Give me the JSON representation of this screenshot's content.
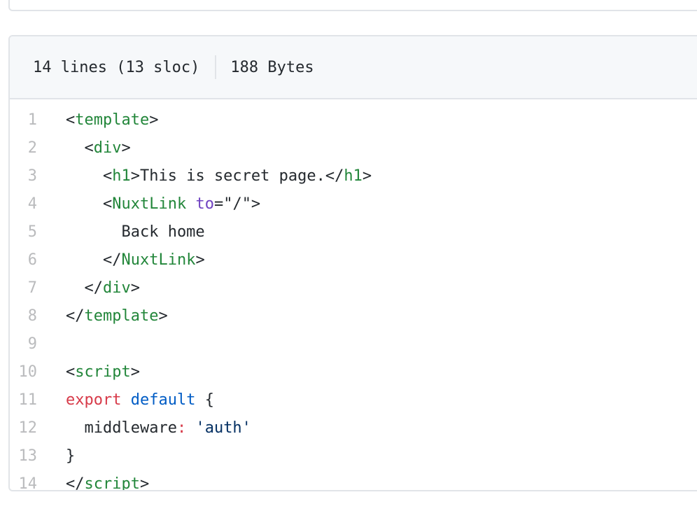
{
  "header": {
    "lines_info": "14 lines (13 sloc)",
    "size_info": "188 Bytes"
  },
  "code": {
    "lines": [
      {
        "num": "1",
        "tokens": [
          {
            "t": "<",
            "c": "plain"
          },
          {
            "t": "template",
            "c": "tag"
          },
          {
            "t": ">",
            "c": "plain"
          }
        ]
      },
      {
        "num": "2",
        "tokens": [
          {
            "t": "  <",
            "c": "plain"
          },
          {
            "t": "div",
            "c": "tag"
          },
          {
            "t": ">",
            "c": "plain"
          }
        ]
      },
      {
        "num": "3",
        "tokens": [
          {
            "t": "    <",
            "c": "plain"
          },
          {
            "t": "h1",
            "c": "tag"
          },
          {
            "t": ">This is secret page.</",
            "c": "plain"
          },
          {
            "t": "h1",
            "c": "tag"
          },
          {
            "t": ">",
            "c": "plain"
          }
        ]
      },
      {
        "num": "4",
        "tokens": [
          {
            "t": "    <",
            "c": "plain"
          },
          {
            "t": "NuxtLink",
            "c": "tag"
          },
          {
            "t": " ",
            "c": "plain"
          },
          {
            "t": "to",
            "c": "attr"
          },
          {
            "t": "=\"/\">",
            "c": "plain"
          }
        ]
      },
      {
        "num": "5",
        "tokens": [
          {
            "t": "      Back home",
            "c": "plain"
          }
        ]
      },
      {
        "num": "6",
        "tokens": [
          {
            "t": "    </",
            "c": "plain"
          },
          {
            "t": "NuxtLink",
            "c": "tag"
          },
          {
            "t": ">",
            "c": "plain"
          }
        ]
      },
      {
        "num": "7",
        "tokens": [
          {
            "t": "  </",
            "c": "plain"
          },
          {
            "t": "div",
            "c": "tag"
          },
          {
            "t": ">",
            "c": "plain"
          }
        ]
      },
      {
        "num": "8",
        "tokens": [
          {
            "t": "</",
            "c": "plain"
          },
          {
            "t": "template",
            "c": "tag"
          },
          {
            "t": ">",
            "c": "plain"
          }
        ]
      },
      {
        "num": "9",
        "tokens": []
      },
      {
        "num": "10",
        "tokens": [
          {
            "t": "<",
            "c": "plain"
          },
          {
            "t": "script",
            "c": "tag"
          },
          {
            "t": ">",
            "c": "plain"
          }
        ]
      },
      {
        "num": "11",
        "tokens": [
          {
            "t": "export",
            "c": "kw"
          },
          {
            "t": " ",
            "c": "plain"
          },
          {
            "t": "default",
            "c": "kw2"
          },
          {
            "t": " {",
            "c": "plain"
          }
        ]
      },
      {
        "num": "12",
        "tokens": [
          {
            "t": "  middleware",
            "c": "plain"
          },
          {
            "t": ":",
            "c": "kw"
          },
          {
            "t": " ",
            "c": "plain"
          },
          {
            "t": "'auth'",
            "c": "str"
          }
        ]
      },
      {
        "num": "13",
        "tokens": [
          {
            "t": "}",
            "c": "plain"
          }
        ]
      },
      {
        "num": "14",
        "tokens": [
          {
            "t": "</",
            "c": "plain"
          },
          {
            "t": "script",
            "c": "tag"
          },
          {
            "t": ">",
            "c": "plain"
          }
        ]
      }
    ]
  }
}
